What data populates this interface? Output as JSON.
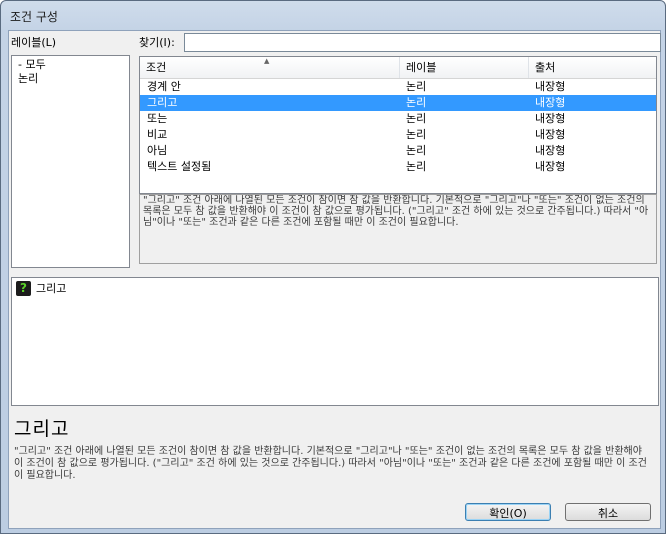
{
  "window": {
    "title": "조건 구성"
  },
  "left": {
    "label": "레이블(L)",
    "items": [
      "- 모두",
      "논리"
    ]
  },
  "find": {
    "label": "찾기(I):",
    "value": ""
  },
  "table": {
    "columns": [
      "조건",
      "레이블",
      "출처"
    ],
    "rows": [
      {
        "condition": "경계 안",
        "label": "논리",
        "source": "내장형"
      },
      {
        "condition": "그리고",
        "label": "논리",
        "source": "내장형"
      },
      {
        "condition": "또는",
        "label": "논리",
        "source": "내장형"
      },
      {
        "condition": "비교",
        "label": "논리",
        "source": "내장형"
      },
      {
        "condition": "아님",
        "label": "논리",
        "source": "내장형"
      },
      {
        "condition": "텍스트 설정됨",
        "label": "논리",
        "source": "내장형"
      }
    ],
    "selected_index": 1
  },
  "description": "\"그리고\" 조건 아래에 나열된 모든 조건이 참이면 참 값을 반환합니다. 기본적으로 \"그리고\"나 \"또는\" 조건이 없는 조건의 목록은 모두 참 값을 반환해야 이 조건이 참 값으로 평가됩니다. (\"그리고\" 조건 하에 있는 것으로 간주됩니다.) 따라서 \"아님\"이나 \"또는\" 조건과 같은 다른 조건에 포함될 때만 이 조건이 필요합니다.",
  "selected_conditions": [
    {
      "icon": "question-icon",
      "label": "그리고"
    }
  ],
  "info": {
    "title": "그리고",
    "description": "\"그리고\" 조건 아래에 나열된 모든 조건이 참이면 참 값을 반환합니다. 기본적으로 \"그리고\"나 \"또는\" 조건이 없는 조건의 목록은 모두 참 값을 반환해야 이 조건이 참 값으로 평가됩니다. (\"그리고\" 조건 하에 있는 것으로 간주됩니다.) 따라서 \"아님\"이나 \"또는\" 조건과 같은 다른 조건에 포함될 때만 이 조건이 필요합니다."
  },
  "buttons": {
    "ok": "확인(O)",
    "cancel": "취소"
  },
  "colors": {
    "selection": "#3399ff",
    "title_bar": "#c4d3e6"
  }
}
